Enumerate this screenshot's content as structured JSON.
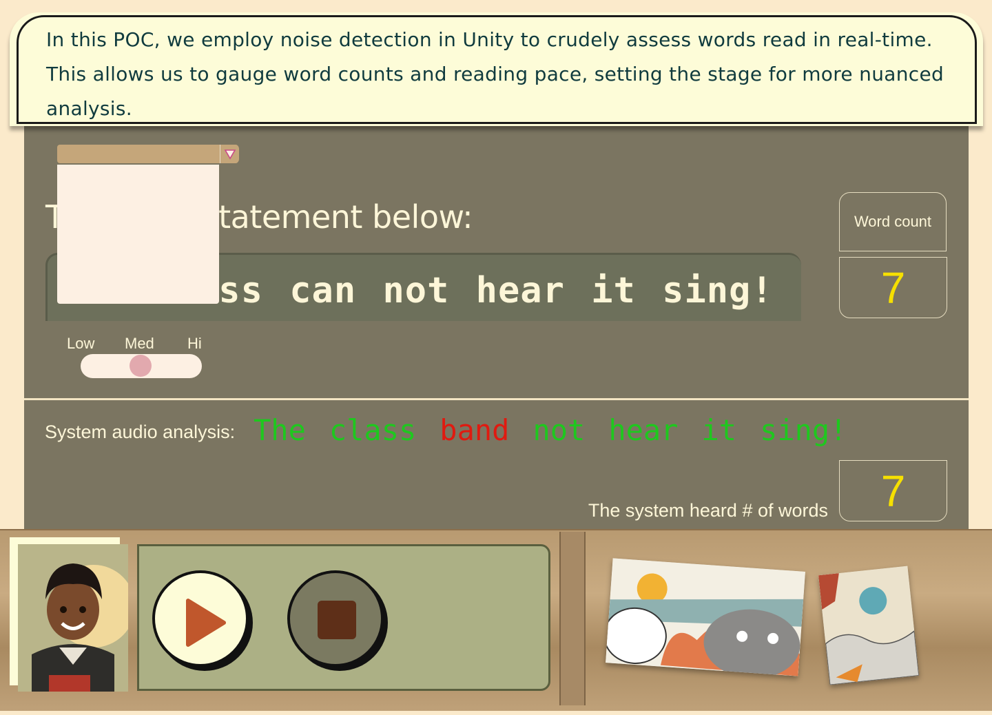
{
  "banner": {
    "text": "In this POC, we employ noise detection in Unity to crudely assess words read in real-time. This allows us to gauge word counts and reading pace, setting the stage for more nuanced analysis."
  },
  "prompt": {
    "heading_visible": "T",
    "heading_rest": "statement below:"
  },
  "statement": {
    "text_visible": "ass can not hear it sing!"
  },
  "sensitivity": {
    "levels": [
      "Low",
      "Med",
      "Hi"
    ],
    "selected": "Med"
  },
  "word_count": {
    "label": "Word count",
    "value": "7"
  },
  "analysis": {
    "label": "System audio analysis:",
    "words": [
      {
        "text": "The",
        "color": "#1ec81e"
      },
      {
        "text": "class",
        "color": "#1ec81e"
      },
      {
        "text": "band",
        "color": "#e01a10"
      },
      {
        "text": "not",
        "color": "#1ec81e"
      },
      {
        "text": "hear",
        "color": "#1ec81e"
      },
      {
        "text": "it",
        "color": "#1ec81e"
      },
      {
        "text": "sing!",
        "color": "#1ec81e"
      }
    ]
  },
  "heard": {
    "label": "The system heard # of words",
    "value": "7"
  },
  "colors": {
    "panel": "#7b7561",
    "accent_yellow": "#f6e000",
    "correct_green": "#1ec81e",
    "error_red": "#e01a10",
    "play_icon": "#c0572c",
    "stop_icon": "#5e2f18"
  },
  "icons": {
    "dropdown": "triangle-down-icon",
    "play": "play-icon",
    "stop": "stop-icon"
  }
}
